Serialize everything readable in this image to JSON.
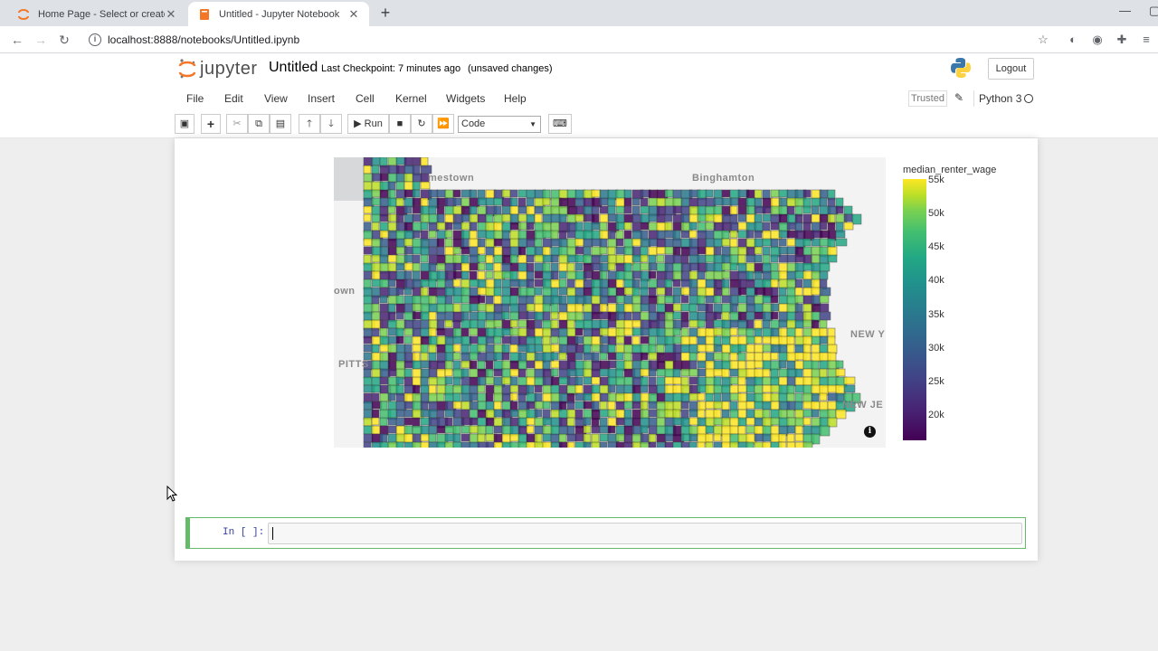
{
  "browser": {
    "tabs": [
      {
        "title": "Home Page - Select or create a n",
        "close": "✕"
      },
      {
        "title": "Untitled - Jupyter Notebook",
        "close": "✕"
      }
    ],
    "new_tab": "+",
    "url": "localhost:8888/notebooks/Untitled.ipynb"
  },
  "jupyter": {
    "logo_text": "jupyter",
    "notebook_title": "Untitled",
    "checkpoint": "Last Checkpoint: 7 minutes ago",
    "unsaved": "(unsaved changes)",
    "logout": "Logout",
    "menu": [
      "File",
      "Edit",
      "View",
      "Insert",
      "Cell",
      "Kernel",
      "Widgets",
      "Help"
    ],
    "trusted": "Trusted",
    "kernel": "Python 3",
    "toolbar": {
      "run_label": "Run",
      "cell_type": "Code"
    }
  },
  "map": {
    "place_labels": [
      "Binghamton",
      "PITTS",
      "NEW Y",
      "NEW JE",
      "mestown",
      "own"
    ],
    "colorbar": {
      "title": "median_renter_wage",
      "ticks": [
        "55k",
        "50k",
        "45k",
        "40k",
        "35k",
        "30k",
        "25k",
        "20k"
      ]
    }
  },
  "cell": {
    "prompt": "In [ ]:"
  },
  "colors": {
    "viridis": [
      "#440154",
      "#482475",
      "#414487",
      "#355f8d",
      "#2a788e",
      "#21918c",
      "#22a884",
      "#44bf70",
      "#7ad151",
      "#bddf26",
      "#fde725"
    ],
    "cell_border": "#66bb6a"
  }
}
